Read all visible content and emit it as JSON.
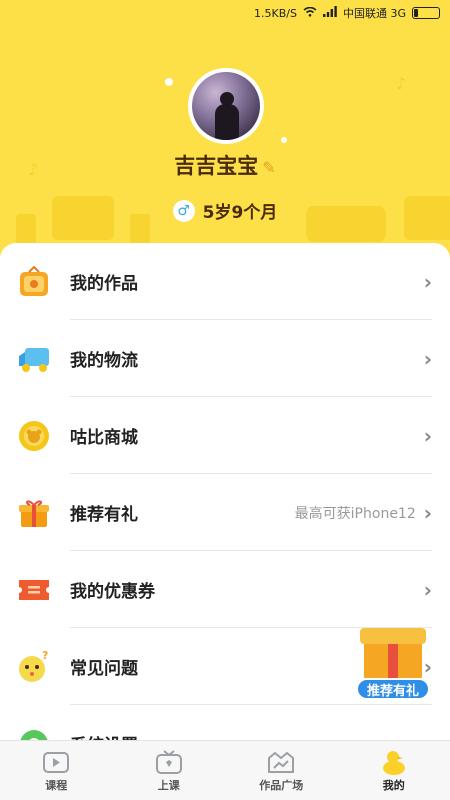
{
  "status_bar": {
    "speed": "1.5KB/S",
    "carrier": "中国联通 3G"
  },
  "profile": {
    "username": "吉吉宝宝",
    "age": "5岁9个月",
    "gender_symbol": "♂"
  },
  "menu": {
    "items": [
      {
        "label": "我的作品",
        "icon": "tv-frame-icon",
        "extra": ""
      },
      {
        "label": "我的物流",
        "icon": "delivery-truck-icon",
        "extra": ""
      },
      {
        "label": "咕比商城",
        "icon": "coin-shop-icon",
        "extra": ""
      },
      {
        "label": "推荐有礼",
        "icon": "gift-box-icon",
        "extra": "最高可获iPhone12"
      },
      {
        "label": "我的优惠券",
        "icon": "coupon-icon",
        "extra": ""
      },
      {
        "label": "常见问题",
        "icon": "question-face-icon",
        "extra": ""
      },
      {
        "label": "系统设置",
        "icon": "settings-icon",
        "extra": ""
      }
    ]
  },
  "promo": {
    "label": "推荐有礼"
  },
  "bottom_nav": {
    "items": [
      {
        "label": "课程",
        "icon": "course-play-icon",
        "active": false
      },
      {
        "label": "上课",
        "icon": "class-tv-icon",
        "active": false
      },
      {
        "label": "作品广场",
        "icon": "gallery-icon",
        "active": false
      },
      {
        "label": "我的",
        "icon": "duck-profile-icon",
        "active": true
      }
    ]
  },
  "colors": {
    "header_bg": "#fde047",
    "text_brown": "#4a2a0d",
    "promo_blue": "#2f8fe6"
  }
}
